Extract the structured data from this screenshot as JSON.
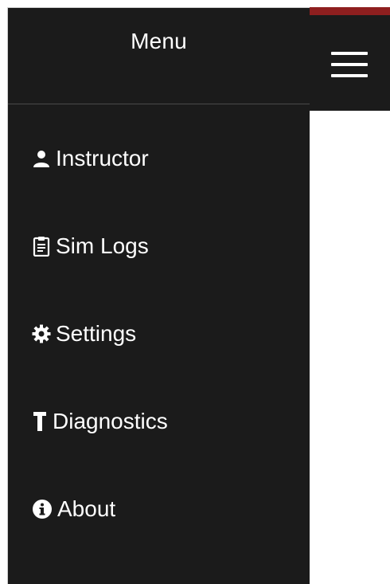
{
  "drawer": {
    "title": "Menu",
    "items": [
      {
        "label": "Instructor",
        "icon": "user-icon"
      },
      {
        "label": "Sim Logs",
        "icon": "clipboard-icon"
      },
      {
        "label": "Settings",
        "icon": "gear-icon"
      },
      {
        "label": "Diagnostics",
        "icon": "hammer-icon"
      },
      {
        "label": "About",
        "icon": "info-icon"
      }
    ]
  },
  "topbar": {
    "menu_icon": "hamburger-icon",
    "accent_color": "#8e1f1f"
  },
  "colors": {
    "drawer_background": "#1b1b1b",
    "text": "#ffffff"
  }
}
